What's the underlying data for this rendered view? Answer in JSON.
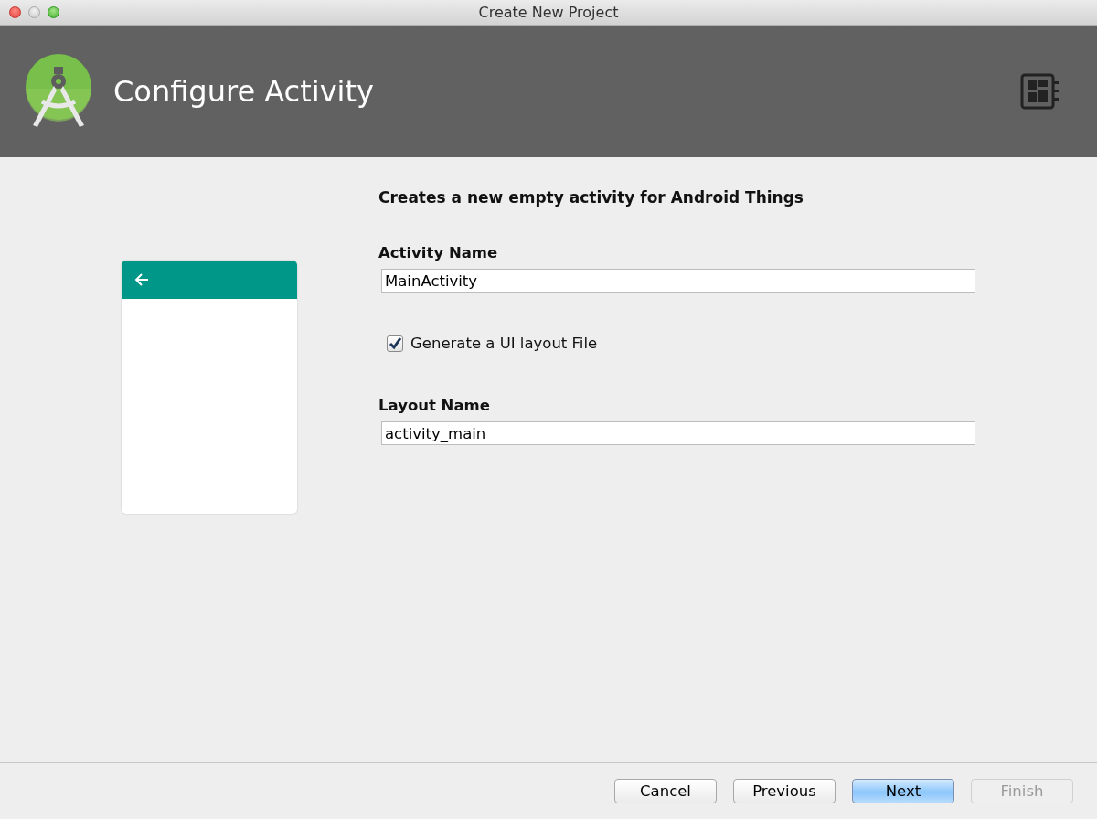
{
  "window": {
    "title": "Create New Project"
  },
  "header": {
    "title": "Configure Activity"
  },
  "description": "Creates a new empty activity for Android Things",
  "fields": [
    {
      "label": "Activity Name",
      "value": "MainActivity"
    },
    {
      "label": "Layout Name",
      "value": "activity_main"
    }
  ],
  "checkbox": {
    "label": "Generate a UI layout File",
    "checked": true
  },
  "buttons": [
    {
      "label": "Cancel",
      "kind": "default",
      "disabled": false
    },
    {
      "label": "Previous",
      "kind": "default",
      "disabled": false
    },
    {
      "label": "Next",
      "kind": "primary",
      "disabled": false
    },
    {
      "label": "Finish",
      "kind": "default",
      "disabled": true
    }
  ]
}
